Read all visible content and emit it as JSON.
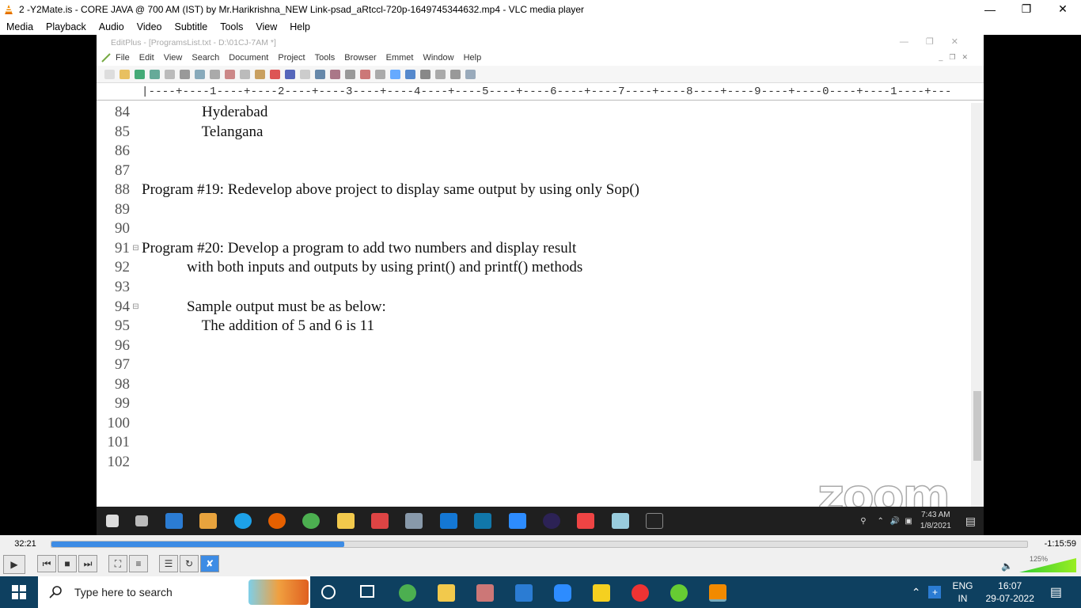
{
  "vlc": {
    "title": "2 -Y2Mate.is - CORE JAVA @ 700 AM (IST) by Mr.Harikrishna_NEW Link-psad_aRtccl-720p-1649745344632.mp4 - VLC media player",
    "menu": [
      "Media",
      "Playback",
      "Audio",
      "Video",
      "Subtitle",
      "Tools",
      "View",
      "Help"
    ],
    "elapsed": "32:21",
    "remaining": "-1:15:59",
    "progress": 0.3,
    "volume_label": "125%"
  },
  "editplus": {
    "title": "EditPlus - [ProgramsList.txt - D:\\01CJ-7AM *]",
    "menu": [
      "File",
      "Edit",
      "View",
      "Search",
      "Document",
      "Project",
      "Tools",
      "Browser",
      "Emmet",
      "Window",
      "Help"
    ],
    "ruler": "|----+----1----+----2----+----3----+----4----+----5----+----6----+----7----+----8----+----9----+----0----+----1----+---",
    "lines": [
      {
        "num": "84",
        "fold": "",
        "text": "                Hyderabad"
      },
      {
        "num": "85",
        "fold": "",
        "text": "                Telangana"
      },
      {
        "num": "86",
        "fold": "",
        "text": ""
      },
      {
        "num": "87",
        "fold": "",
        "text": ""
      },
      {
        "num": "88",
        "fold": "",
        "text": "Program #19: Redevelop above project to display same output by using only Sop()"
      },
      {
        "num": "89",
        "fold": "",
        "text": ""
      },
      {
        "num": "90",
        "fold": "",
        "text": ""
      },
      {
        "num": "91",
        "fold": "⊟",
        "text": "Program #20: Develop a program to add two numbers and display result"
      },
      {
        "num": "92",
        "fold": "",
        "text": "            with both inputs and outputs by using print() and printf() methods"
      },
      {
        "num": "93",
        "fold": "",
        "text": ""
      },
      {
        "num": "94",
        "fold": "⊟",
        "text": "            Sample output must be as below:"
      },
      {
        "num": "95",
        "fold": "",
        "text": "                The addition of 5 and 6 is 11"
      },
      {
        "num": "96",
        "fold": "",
        "text": ""
      },
      {
        "num": "97",
        "fold": "",
        "text": ""
      },
      {
        "num": "98",
        "fold": "",
        "text": ""
      },
      {
        "num": "99",
        "fold": "",
        "text": ""
      },
      {
        "num": "100",
        "fold": "",
        "text": ""
      },
      {
        "num": "101",
        "fold": "",
        "text": ""
      },
      {
        "num": "102",
        "fold": "",
        "text": ""
      }
    ],
    "watermark": "zoom"
  },
  "inner_taskbar": {
    "time": "7:43 AM",
    "date": "1/8/2021"
  },
  "taskbar": {
    "search_placeholder": "Type here to search",
    "lang": "ENG",
    "region": "IN",
    "time": "16:07",
    "date": "29-07-2022"
  }
}
